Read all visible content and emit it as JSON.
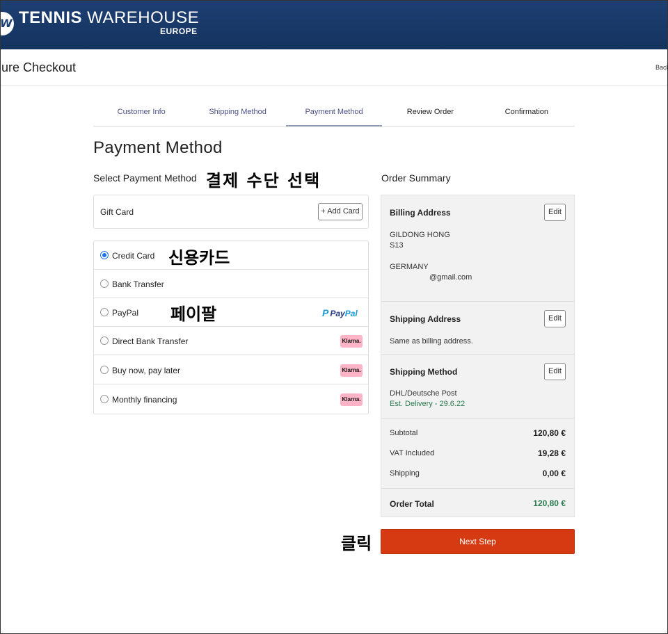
{
  "header": {
    "logo_letter": "W",
    "brand_bold": "TENNIS",
    "brand_light": " WAREHOUSE",
    "brand_sub": "EUROPE",
    "colors": {
      "header_bg": "#1e3f73",
      "next_step_bg": "#d63a12",
      "accent_green": "#2a7a4f"
    }
  },
  "subbar": {
    "title": "ure Checkout",
    "back": "Back"
  },
  "steps": [
    {
      "label": "Customer Info"
    },
    {
      "label": "Shipping Method"
    },
    {
      "label": "Payment Method",
      "active": true
    },
    {
      "label": "Review Order"
    },
    {
      "label": "Confirmation"
    }
  ],
  "page_title": "Payment Method",
  "payment": {
    "section_title": "Select Payment Method",
    "gift_card": {
      "label": "Gift Card",
      "button": "+ Add Card"
    },
    "options": [
      {
        "label": "Credit Card",
        "selected": true,
        "logo": null
      },
      {
        "label": "Bank Transfer",
        "selected": false,
        "logo": null
      },
      {
        "label": "PayPal",
        "selected": false,
        "logo": "PayPal"
      },
      {
        "label": "Direct Bank Transfer",
        "selected": false,
        "logo": "Klarna."
      },
      {
        "label": "Buy now, pay later",
        "selected": false,
        "logo": "Klarna."
      },
      {
        "label": "Monthly financing",
        "selected": false,
        "logo": "Klarna."
      }
    ],
    "paypal_logo": {
      "pay": "Pay",
      "pal": "Pal",
      "mark": "P"
    }
  },
  "annotations": {
    "select_method": "결제 수단 선택",
    "credit_card": "신용카드",
    "paypal": "페이팔",
    "click": "클릭"
  },
  "summary": {
    "title": "Order Summary",
    "billing": {
      "heading": "Billing Address",
      "edit": "Edit",
      "name": "GILDONG HONG",
      "line2": "S13",
      "country": "GERMANY",
      "email": "@gmail.com"
    },
    "shipping_address": {
      "heading": "Shipping Address",
      "edit": "Edit",
      "text": "Same as billing address."
    },
    "shipping_method": {
      "heading": "Shipping Method",
      "edit": "Edit",
      "carrier": "DHL/Deutsche Post",
      "delivery": "Est. Delivery - 29.6.22"
    },
    "totals": [
      {
        "label": "Subtotal",
        "value": "120,80 €"
      },
      {
        "label": "VAT Included",
        "value": "19,28 €"
      },
      {
        "label": "Shipping",
        "value": "0,00 €"
      }
    ],
    "order_total": {
      "label": "Order Total",
      "value": "120,80 €"
    }
  },
  "next_step": "Next Step"
}
